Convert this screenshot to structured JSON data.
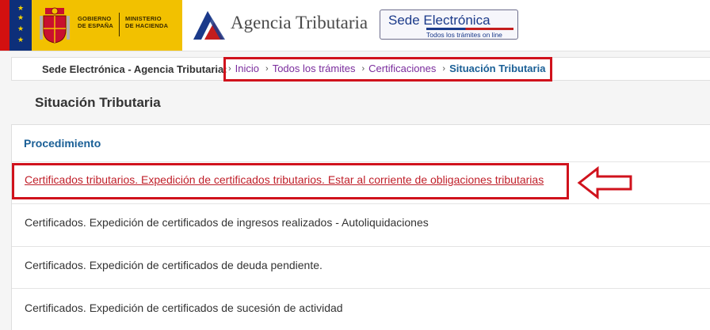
{
  "header": {
    "gov_line1": "Gobierno",
    "gov_line2": "de España",
    "ministry_line1": "Ministerio",
    "ministry_line2": "de Hacienda",
    "agency_name": "Agencia Tributaria",
    "sede_title": "Sede Electrónica",
    "sede_subtitle": "Todos los trámites on line",
    "colors": {
      "gov_yellow": "#f2c100",
      "brand_blue": "#1b3a8a",
      "brand_red": "#c41d1d"
    }
  },
  "breadcrumb": {
    "site_label": "Sede Electrónica - Agencia Tributaria:",
    "separator": "›",
    "items": [
      {
        "label": "Inicio"
      },
      {
        "label": "Todos los trámites"
      },
      {
        "label": "Certificaciones"
      }
    ],
    "current": "Situación Tributaria"
  },
  "page": {
    "title": "Situación Tributaria"
  },
  "procedures": {
    "header": "Procedimiento",
    "items": [
      {
        "label": "Certificados tributarios. Expedición de certificados tributarios. Estar al corriente de obligaciones tributarias",
        "highlighted": true
      },
      {
        "label": "Certificados. Expedición de certificados de ingresos realizados - Autoliquidaciones"
      },
      {
        "label": "Certificados. Expedición de certificados de deuda pendiente."
      },
      {
        "label": "Certificados. Expedición de certificados de sucesión de actividad"
      }
    ]
  },
  "annotation_color": "#d0121c"
}
